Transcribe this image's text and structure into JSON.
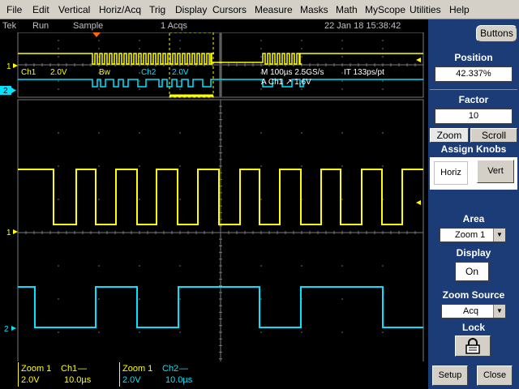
{
  "menu": [
    "File",
    "Edit",
    "Vertical",
    "Horiz/Acq",
    "Trig",
    "Display",
    "Cursors",
    "Measure",
    "Masks",
    "Math",
    "MyScope",
    "Utilities",
    "Help"
  ],
  "status": {
    "brand": "Tek",
    "run_state": "Run",
    "acq_mode": "Sample",
    "acq_count": "1 Acqs",
    "datetime": "22 Jan 18 15:38:42"
  },
  "overview": {
    "ch1_label": "Ch1",
    "ch1_scale": "2.0V",
    "bw": "Bw",
    "ch2_label": "Ch2",
    "ch2_scale": "2.0V",
    "timebase": "M 100µs 2.5GS/s",
    "sample_interval": "IT 133ps/pt",
    "trigger": "A  Ch1 ↗ 1.6V"
  },
  "panel": {
    "buttons_label": "Buttons",
    "position_label": "Position",
    "position_value": "42.337%",
    "factor_label": "Factor",
    "factor_value": "10",
    "tab_zoom": "Zoom",
    "tab_scroll": "Scroll",
    "assign_knobs_label": "Assign Knobs",
    "horiz_label": "Horiz",
    "vert_label": "Vert",
    "area_label": "Area",
    "area_value": "Zoom 1",
    "display_label": "Display",
    "display_value": "On",
    "zoom_source_label": "Zoom Source",
    "zoom_source_value": "Acq",
    "lock_label": "Lock",
    "setup_label": "Setup",
    "close_label": "Close"
  },
  "channel_markers": {
    "ch1": "1",
    "ch2": "2"
  },
  "readouts": [
    {
      "title": "Zoom 1",
      "channel": "Ch1",
      "volts": "2.0V",
      "time": "10.0µs"
    },
    {
      "title": "Zoom 1",
      "channel": "Ch2",
      "volts": "2.0V",
      "time": "10.0µs"
    }
  ],
  "colors": {
    "ch1": "#ffff00",
    "ch2": "#00e5ff",
    "panel_bg": "#1c3c78",
    "grid": "#7a7a7a"
  }
}
